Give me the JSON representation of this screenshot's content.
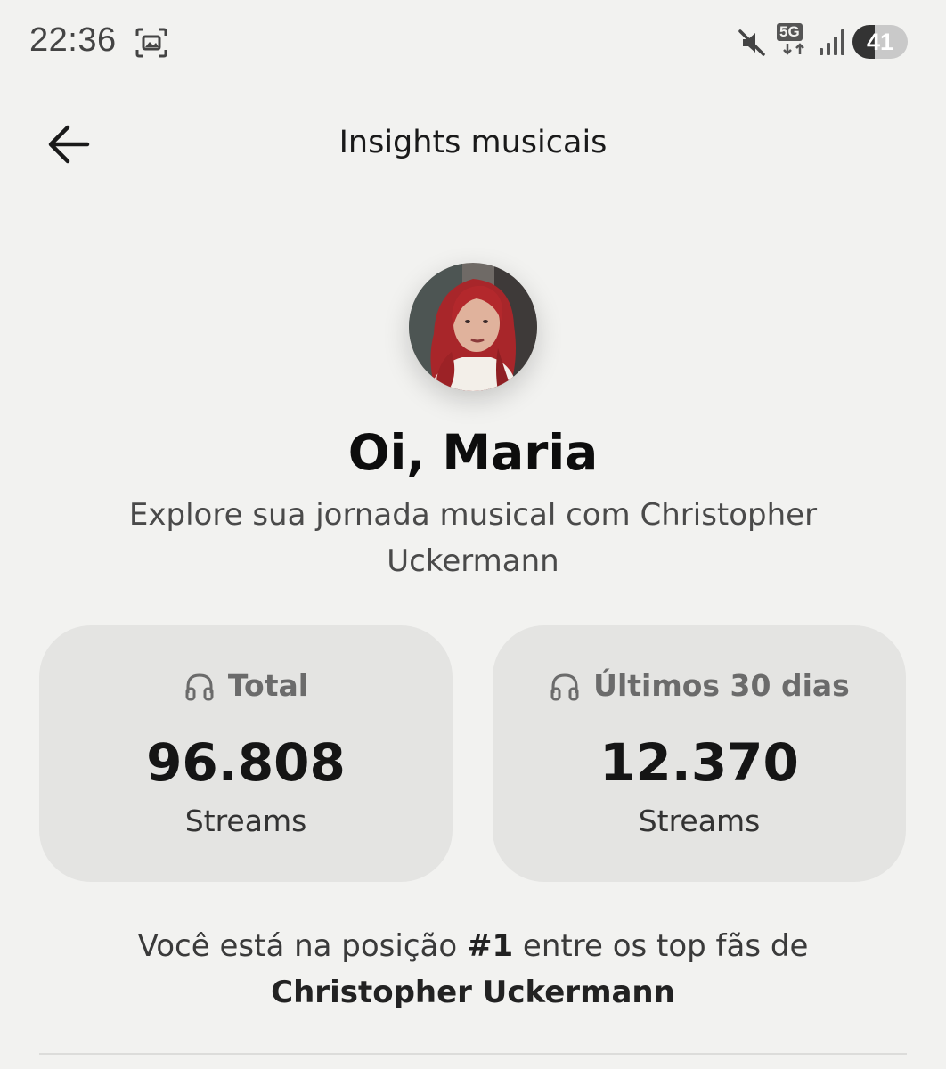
{
  "status_bar": {
    "time": "22:36",
    "network_label": "5G",
    "battery_level": "41",
    "battery_fraction": 0.41
  },
  "header": {
    "back_icon": "arrow-left-icon",
    "title": "Insights musicais"
  },
  "profile": {
    "greeting": "Oi, Maria",
    "subtitle": "Explore sua jornada musical com Christopher Uckermann"
  },
  "stats": [
    {
      "icon": "headphones-icon",
      "label": "Total",
      "value": "96.808",
      "unit": "Streams"
    },
    {
      "icon": "headphones-icon",
      "label": "Últimos 30 dias",
      "value": "12.370",
      "unit": "Streams"
    }
  ],
  "ranking": {
    "prefix": "Você está na posição ",
    "position": "#1",
    "middle": " entre os top fãs de ",
    "artist": "Christopher Uckermann"
  },
  "colors": {
    "background": "#f2f2f0",
    "card": "#e4e4e2",
    "text": "#111111"
  }
}
